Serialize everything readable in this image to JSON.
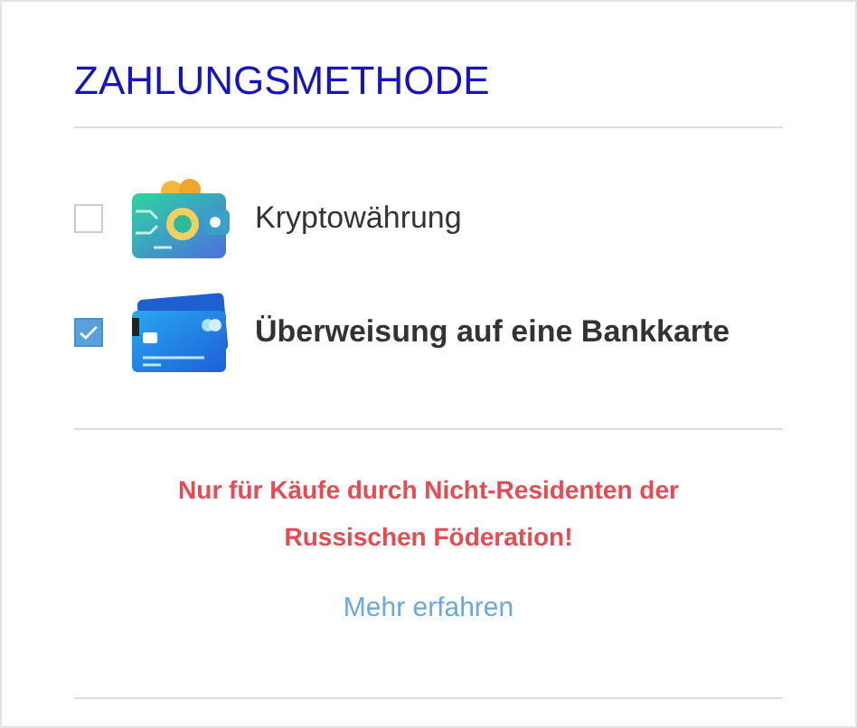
{
  "title": "ZAHLUNGSMETHODE",
  "options": [
    {
      "kind": "crypto",
      "label": "Kryptowährung",
      "selected": false
    },
    {
      "kind": "card",
      "label": "Überweisung auf eine Bankkarte",
      "selected": true
    }
  ],
  "notice": "Nur für Käufe durch Nicht-Residenten der Russischen Föderation!",
  "link": "Mehr erfahren"
}
